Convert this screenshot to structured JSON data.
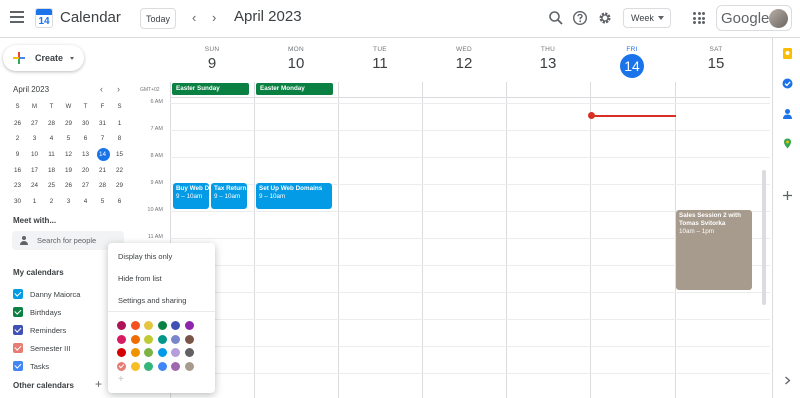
{
  "header": {
    "app_title": "Calendar",
    "logo_day": "14",
    "today_label": "Today",
    "prev_label": "‹",
    "next_label": "›",
    "period": "April 2023",
    "view_label": "Week",
    "account_brand": "Google"
  },
  "sidebar": {
    "create_label": "Create",
    "mini_title": "April 2023",
    "mini_prev": "‹",
    "mini_next": "›",
    "weekday_heads": [
      "S",
      "M",
      "T",
      "W",
      "T",
      "F",
      "S"
    ],
    "weeks": [
      [
        "26",
        "27",
        "28",
        "29",
        "30",
        "31",
        "1"
      ],
      [
        "2",
        "3",
        "4",
        "5",
        "6",
        "7",
        "8"
      ],
      [
        "9",
        "10",
        "11",
        "12",
        "13",
        "14",
        "15"
      ],
      [
        "16",
        "17",
        "18",
        "19",
        "20",
        "21",
        "22"
      ],
      [
        "23",
        "24",
        "25",
        "26",
        "27",
        "28",
        "29"
      ],
      [
        "30",
        "1",
        "2",
        "3",
        "4",
        "5",
        "6"
      ]
    ],
    "meet_title": "Meet with...",
    "search_placeholder": "Search for people",
    "my_calendars_title": "My calendars",
    "calendars": [
      {
        "name": "Danny Maiorca",
        "color": "#039be5"
      },
      {
        "name": "Birthdays",
        "color": "#0b8043"
      },
      {
        "name": "Reminders",
        "color": "#3f51b5"
      },
      {
        "name": "Semester III",
        "color": "#e67c73"
      },
      {
        "name": "Tasks",
        "color": "#4285f4"
      }
    ],
    "other_calendars_title": "Other calendars",
    "other_add": "+"
  },
  "week": {
    "timezone": "GMT+02",
    "days": [
      {
        "name": "SUN",
        "date": "9"
      },
      {
        "name": "MON",
        "date": "10"
      },
      {
        "name": "TUE",
        "date": "11"
      },
      {
        "name": "WED",
        "date": "12"
      },
      {
        "name": "THU",
        "date": "13"
      },
      {
        "name": "FRI",
        "date": "14",
        "today": true
      },
      {
        "name": "SAT",
        "date": "15"
      }
    ],
    "times": [
      "6 AM",
      "7 AM",
      "8 AM",
      "9 AM",
      "10 AM",
      "11 AM"
    ],
    "allday_events": [
      {
        "title": "Easter Sunday",
        "day": 0
      },
      {
        "title": "Easter Monday",
        "day": 1
      }
    ],
    "events": {
      "buy_web": {
        "title": "Buy Web Do",
        "time": "9 – 10am"
      },
      "tax_return": {
        "title": "Tax Return",
        "time": "9 – 10am"
      },
      "setup_web": {
        "title": "Set Up Web Domains",
        "time": "9 – 10am"
      },
      "sales": {
        "title": "Sales Session 2 with Tomas Svitorka",
        "time": "10am – 1pm"
      }
    }
  },
  "context_menu": {
    "items": [
      "Display this only",
      "Hide from list",
      "Settings and sharing"
    ],
    "colors": [
      [
        "#ad1457",
        "#f4511e",
        "#e4c441",
        "#0b8043",
        "#3f51b5",
        "#8e24aa"
      ],
      [
        "#d81b60",
        "#ef6c00",
        "#c0ca33",
        "#009688",
        "#7986cb",
        "#795548"
      ],
      [
        "#d50000",
        "#f09300",
        "#7cb342",
        "#039be5",
        "#b39ddb",
        "#616161"
      ],
      [
        "#e67c73",
        "#f6bf26",
        "#33b679",
        "#4285f4",
        "#9e69af",
        "#a79b8e"
      ]
    ],
    "selected_color": "#e67c73",
    "add_color": "+"
  }
}
